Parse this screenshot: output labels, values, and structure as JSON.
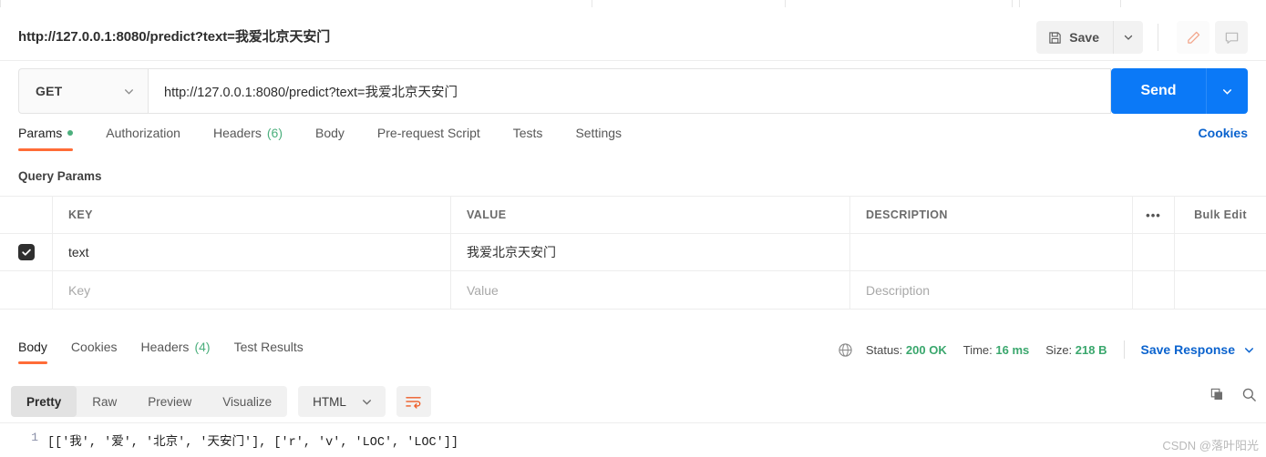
{
  "request": {
    "title": "http://127.0.0.1:8080/predict?text=我爱北京天安门",
    "save_label": "Save",
    "method": "GET",
    "url": "http://127.0.0.1:8080/predict?text=我爱北京天安门",
    "send_label": "Send",
    "cookies_label": "Cookies",
    "tabs": [
      {
        "label": "Params",
        "count": "",
        "active": true,
        "dot": true
      },
      {
        "label": "Authorization",
        "count": "",
        "active": false,
        "dot": false
      },
      {
        "label": "Headers",
        "count": "(6)",
        "active": false,
        "dot": false
      },
      {
        "label": "Body",
        "count": "",
        "active": false,
        "dot": false
      },
      {
        "label": "Pre-request Script",
        "count": "",
        "active": false,
        "dot": false
      },
      {
        "label": "Tests",
        "count": "",
        "active": false,
        "dot": false
      },
      {
        "label": "Settings",
        "count": "",
        "active": false,
        "dot": false
      }
    ]
  },
  "params": {
    "section_label": "Query Params",
    "headers": {
      "key": "KEY",
      "value": "VALUE",
      "description": "DESCRIPTION",
      "bulk_edit": "Bulk Edit"
    },
    "rows": [
      {
        "checked": true,
        "key": "text",
        "value": "我爱北京天安门",
        "description": ""
      }
    ],
    "empty_row": {
      "key_placeholder": "Key",
      "value_placeholder": "Value",
      "description_placeholder": "Description"
    }
  },
  "response": {
    "tabs": [
      {
        "label": "Body",
        "count": "",
        "active": true
      },
      {
        "label": "Cookies",
        "count": "",
        "active": false
      },
      {
        "label": "Headers",
        "count": "(4)",
        "active": false
      },
      {
        "label": "Test Results",
        "count": "",
        "active": false
      }
    ],
    "status_label": "Status:",
    "status_value": "200 OK",
    "time_label": "Time:",
    "time_value": "16 ms",
    "size_label": "Size:",
    "size_value": "218 B",
    "save_response_label": "Save Response",
    "view_modes": [
      {
        "label": "Pretty",
        "active": true
      },
      {
        "label": "Raw",
        "active": false
      },
      {
        "label": "Preview",
        "active": false
      },
      {
        "label": "Visualize",
        "active": false
      }
    ],
    "format": "HTML",
    "line_number": "1",
    "body_line": "[['我', '爱', '北京', '天安门'], ['r', 'v', 'LOC', 'LOC']]"
  },
  "watermark": "CSDN @落叶阳光",
  "colors": {
    "accent_orange": "#ff6c37",
    "send_blue": "#0b79f7",
    "link_blue": "#0b63ce",
    "status_green": "#3aa76d"
  }
}
